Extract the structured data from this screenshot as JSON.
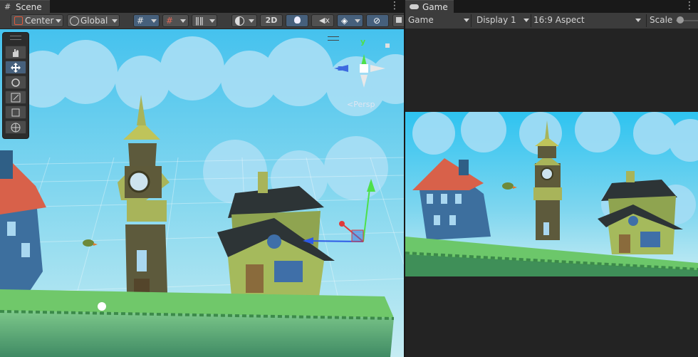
{
  "scene_panel": {
    "tab_title": "Scene",
    "toolbar": {
      "pivot_label": "Center",
      "space_label": "Global",
      "mode_2d_label": "2D"
    },
    "gizmo": {
      "axis_y": "y",
      "axis_z": "z",
      "projection_label": "Persp"
    },
    "tools": [
      "hand-tool",
      "move-tool",
      "rotate-tool",
      "scale-tool",
      "rect-tool",
      "transform-tool"
    ]
  },
  "game_panel": {
    "tab_title": "Game",
    "toolbar": {
      "view_label": "Game",
      "display_label": "Display 1",
      "aspect_label": "16:9 Aspect",
      "scale_label": "Scale"
    }
  },
  "colors": {
    "sky": "#5fd0f0",
    "ground": "#6fd36a",
    "active_tool": "#46607c"
  }
}
